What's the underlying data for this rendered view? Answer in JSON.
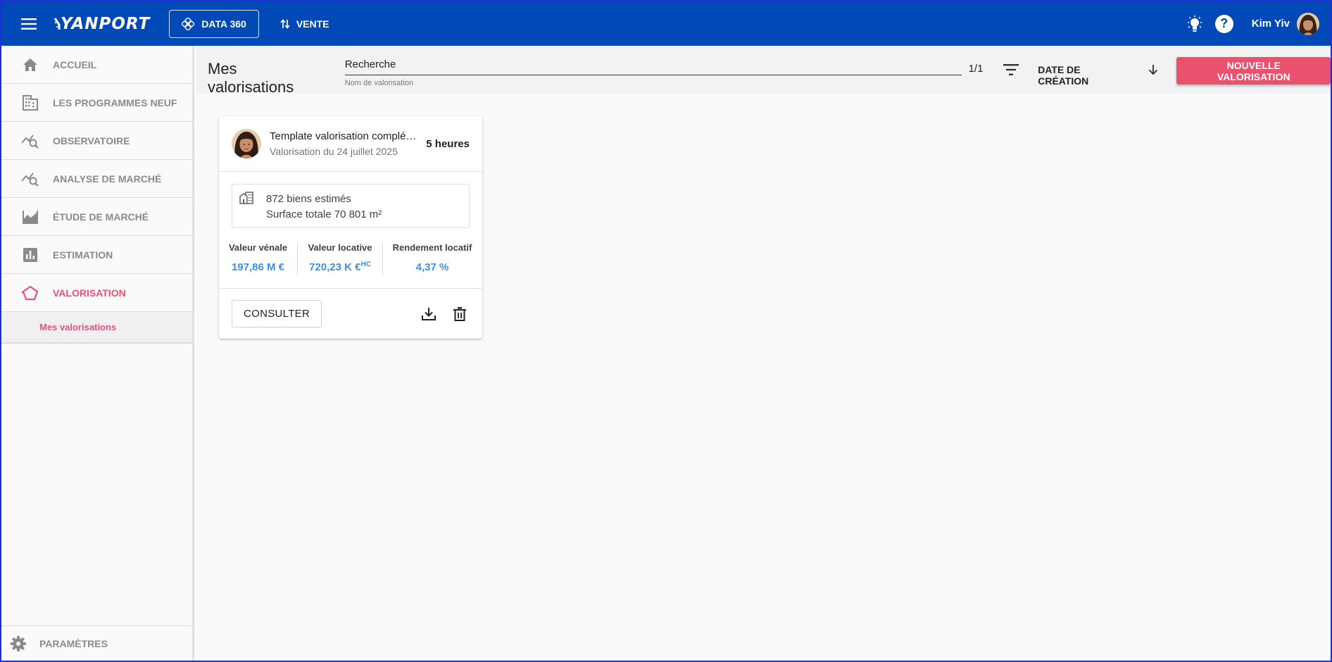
{
  "colors": {
    "topbar": "#0049b7",
    "accent": "#e9516f",
    "value": "#3d8ee8"
  },
  "topbar": {
    "logo": "YANPORT",
    "data360_label": "DATA 360",
    "vente_label": "VENTE",
    "user_name": "Kim Yiv",
    "help_symbol": "?"
  },
  "sidebar": {
    "items": [
      {
        "label": "ACCUEIL",
        "icon": "home-icon"
      },
      {
        "label": "LES PROGRAMMES NEUF",
        "icon": "building-icon"
      },
      {
        "label": "OBSERVATOIRE",
        "icon": "chart-search-icon"
      },
      {
        "label": "ANALYSE DE MARCHÉ",
        "icon": "chart-search-icon"
      },
      {
        "label": "ÉTUDE DE MARCHÉ",
        "icon": "landscape-chart-icon"
      },
      {
        "label": "ESTIMATION",
        "icon": "bar-chart-icon"
      },
      {
        "label": "VALORISATION",
        "icon": "house-outline-icon"
      }
    ],
    "sub_item": "Mes valorisations",
    "settings_label": "PARAMÈTRES"
  },
  "header": {
    "title": "Mes valorisations",
    "search_value": "Recherche",
    "search_hint": "Nom de valorisation",
    "pager": "1/1",
    "sort_label": "DATE DE CRÉATION",
    "new_button": "NOUVELLE VALORISATION"
  },
  "card": {
    "title": "Template valorisation complé…",
    "subtitle": "Valorisation du 24 juillet 2025",
    "age": "5 heures",
    "info_line1": "872 biens estimés",
    "info_line2": "Surface totale 70 801 m²",
    "metrics": [
      {
        "label": "Valeur vénale",
        "value": "197,86 M €"
      },
      {
        "label": "Valeur locative",
        "value": "720,23 K €",
        "sup": "HC"
      },
      {
        "label": "Rendement locatif",
        "value": "4,37 %"
      }
    ],
    "consult_label": "CONSULTER"
  }
}
